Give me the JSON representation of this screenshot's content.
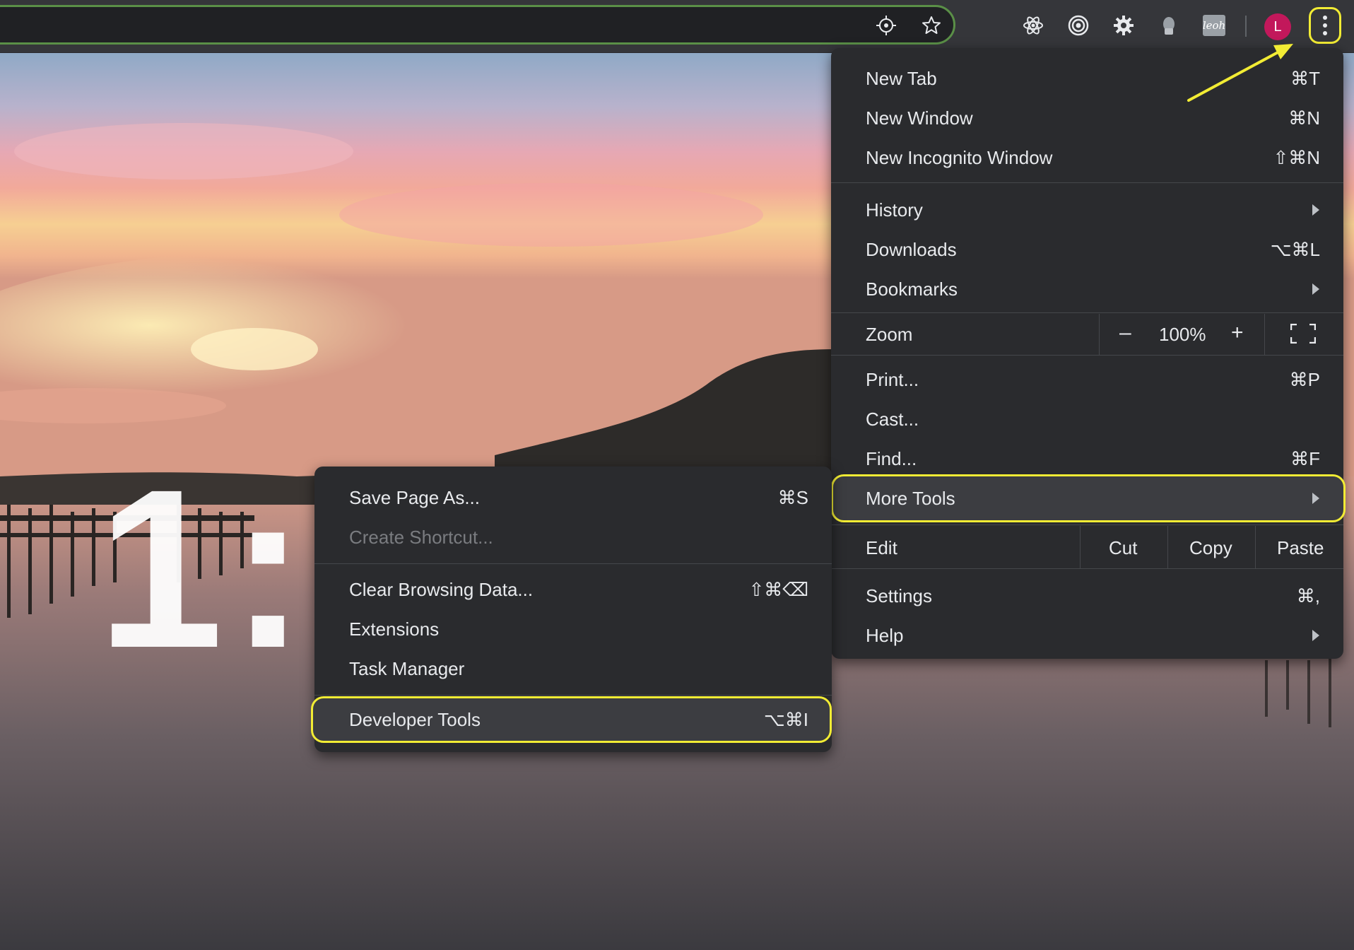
{
  "toolbar": {
    "avatar_letter": "L",
    "extension_icons": [
      "crosshair-icon",
      "star-icon",
      "react-atom-icon",
      "target-icon",
      "gear-icon",
      "bulb-icon",
      "leoh-icon"
    ],
    "leoh_text": "leoh"
  },
  "wallpaper": {
    "clock_text": "1:"
  },
  "main_menu": {
    "new_tab": {
      "label": "New Tab",
      "shortcut": "⌘T"
    },
    "new_window": {
      "label": "New Window",
      "shortcut": "⌘N"
    },
    "new_incognito": {
      "label": "New Incognito Window",
      "shortcut": "⇧⌘N"
    },
    "history": {
      "label": "History"
    },
    "downloads": {
      "label": "Downloads",
      "shortcut": "⌥⌘L"
    },
    "bookmarks": {
      "label": "Bookmarks"
    },
    "zoom": {
      "label": "Zoom",
      "minus": "–",
      "value": "100%",
      "plus": "+"
    },
    "print": {
      "label": "Print...",
      "shortcut": "⌘P"
    },
    "cast": {
      "label": "Cast..."
    },
    "find": {
      "label": "Find...",
      "shortcut": "⌘F"
    },
    "more_tools": {
      "label": "More Tools"
    },
    "edit": {
      "label": "Edit",
      "cut": "Cut",
      "copy": "Copy",
      "paste": "Paste"
    },
    "settings": {
      "label": "Settings",
      "shortcut": "⌘,"
    },
    "help": {
      "label": "Help"
    }
  },
  "sub_menu": {
    "save_page": {
      "label": "Save Page As...",
      "shortcut": "⌘S"
    },
    "create_shortcut": {
      "label": "Create Shortcut..."
    },
    "clear_data": {
      "label": "Clear Browsing Data...",
      "shortcut": "⇧⌘⌫"
    },
    "extensions": {
      "label": "Extensions"
    },
    "task_manager": {
      "label": "Task Manager"
    },
    "developer_tools": {
      "label": "Developer Tools",
      "shortcut": "⌥⌘I"
    }
  },
  "colors": {
    "highlight": "#f2ec34",
    "menu_bg": "#2a2b2e",
    "toolbar_bg": "#35363a",
    "avatar": "#c2185b"
  }
}
